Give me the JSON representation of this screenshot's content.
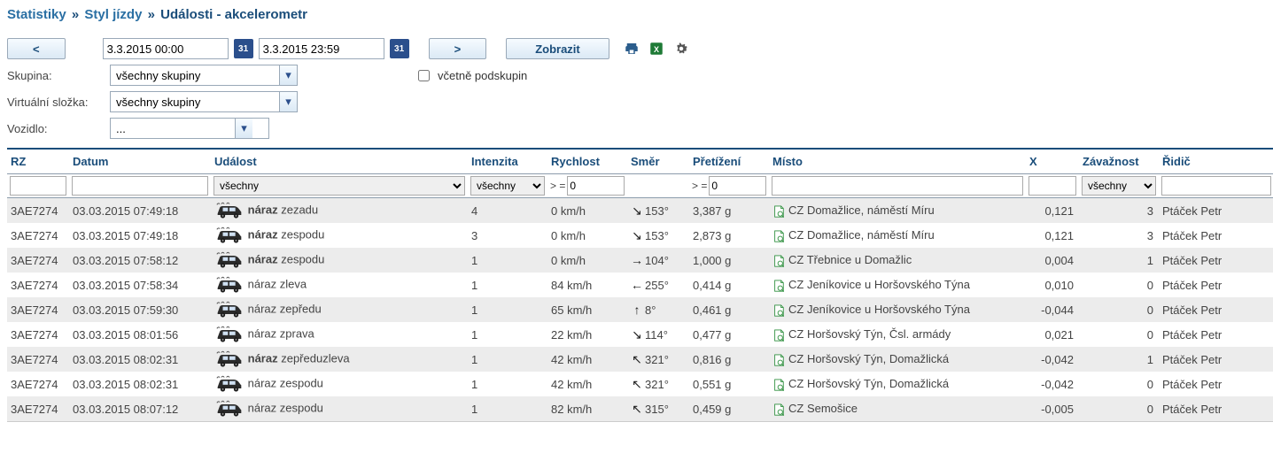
{
  "breadcrumb": {
    "a": "Statistiky",
    "b": "Styl jízdy",
    "c": "Události - akcelerometr"
  },
  "toolbar": {
    "prev": "<",
    "next": ">",
    "date_from": "3.3.2015 00:00",
    "date_to": "3.3.2015 23:59",
    "cal": "31",
    "show": "Zobrazit"
  },
  "filters": {
    "group_label": "Skupina:",
    "group_value": "všechny skupiny",
    "include_sub": "včetně podskupin",
    "vfolder_label": "Virtuální složka:",
    "vfolder_value": "všechny skupiny",
    "vehicle_label": "Vozidlo:",
    "vehicle_value": "..."
  },
  "headers": {
    "rz": "RZ",
    "date": "Datum",
    "event": "Událost",
    "intensity": "Intenzita",
    "speed": "Rychlost",
    "dir": "Směr",
    "g": "Přetížení",
    "place": "Místo",
    "x": "X",
    "sev": "Závažnost",
    "driver": "Řidič"
  },
  "col_filters": {
    "event_all": "všechny",
    "intensity_all": "všechny",
    "speed_op": "> =",
    "speed_val": "0",
    "g_op": "> =",
    "g_val": "0",
    "sev_all": "všechny"
  },
  "rows": [
    {
      "rz": "3AE7274",
      "date": "03.03.2015 07:49:18",
      "ev_pre": "náraz",
      "ev_suf": "zezadu",
      "bold": true,
      "int": "4",
      "spd": "0 km/h",
      "arr": "↘",
      "deg": "153°",
      "g": "3,387 g",
      "place": "CZ Domažlice, náměstí Míru",
      "x": "0,121",
      "sev": "3",
      "drv": "Ptáček Petr"
    },
    {
      "rz": "3AE7274",
      "date": "03.03.2015 07:49:18",
      "ev_pre": "náraz",
      "ev_suf": "zespodu",
      "bold": true,
      "int": "3",
      "spd": "0 km/h",
      "arr": "↘",
      "deg": "153°",
      "g": "2,873 g",
      "place": "CZ Domažlice, náměstí Míru",
      "x": "0,121",
      "sev": "3",
      "drv": "Ptáček Petr"
    },
    {
      "rz": "3AE7274",
      "date": "03.03.2015 07:58:12",
      "ev_pre": "náraz",
      "ev_suf": "zespodu",
      "bold": true,
      "int": "1",
      "spd": "0 km/h",
      "arr": "→",
      "deg": "104°",
      "g": "1,000 g",
      "place": "CZ Třebnice u Domažlic",
      "x": "0,004",
      "sev": "1",
      "drv": "Ptáček Petr"
    },
    {
      "rz": "3AE7274",
      "date": "03.03.2015 07:58:34",
      "ev_pre": "",
      "ev_suf": "náraz zleva",
      "bold": false,
      "int": "1",
      "spd": "84 km/h",
      "arr": "←",
      "deg": "255°",
      "g": "0,414 g",
      "place": "CZ Jeníkovice u Horšovského Týna",
      "x": "0,010",
      "sev": "0",
      "drv": "Ptáček Petr"
    },
    {
      "rz": "3AE7274",
      "date": "03.03.2015 07:59:30",
      "ev_pre": "",
      "ev_suf": "náraz zepředu",
      "bold": false,
      "int": "1",
      "spd": "65 km/h",
      "arr": "↑",
      "deg": "8°",
      "g": "0,461 g",
      "place": "CZ Jeníkovice u Horšovského Týna",
      "x": "-0,044",
      "sev": "0",
      "drv": "Ptáček Petr"
    },
    {
      "rz": "3AE7274",
      "date": "03.03.2015 08:01:56",
      "ev_pre": "",
      "ev_suf": "náraz zprava",
      "bold": false,
      "int": "1",
      "spd": "22 km/h",
      "arr": "↘",
      "deg": "114°",
      "g": "0,477 g",
      "place": "CZ Horšovský Týn, Čsl. armády",
      "x": "0,021",
      "sev": "0",
      "drv": "Ptáček Petr"
    },
    {
      "rz": "3AE7274",
      "date": "03.03.2015 08:02:31",
      "ev_pre": "náraz",
      "ev_suf": "zepředuzleva",
      "bold": true,
      "int": "1",
      "spd": "42 km/h",
      "arr": "↖",
      "deg": "321°",
      "g": "0,816 g",
      "place": "CZ Horšovský Týn, Domažlická",
      "x": "-0,042",
      "sev": "1",
      "drv": "Ptáček Petr"
    },
    {
      "rz": "3AE7274",
      "date": "03.03.2015 08:02:31",
      "ev_pre": "",
      "ev_suf": "náraz zespodu",
      "bold": false,
      "int": "1",
      "spd": "42 km/h",
      "arr": "↖",
      "deg": "321°",
      "g": "0,551 g",
      "place": "CZ Horšovský Týn, Domažlická",
      "x": "-0,042",
      "sev": "0",
      "drv": "Ptáček Petr"
    },
    {
      "rz": "3AE7274",
      "date": "03.03.2015 08:07:12",
      "ev_pre": "",
      "ev_suf": "náraz zespodu",
      "bold": false,
      "int": "1",
      "spd": "82 km/h",
      "arr": "↖",
      "deg": "315°",
      "g": "0,459 g",
      "place": "CZ Semošice",
      "x": "-0,005",
      "sev": "0",
      "drv": "Ptáček Petr"
    }
  ]
}
